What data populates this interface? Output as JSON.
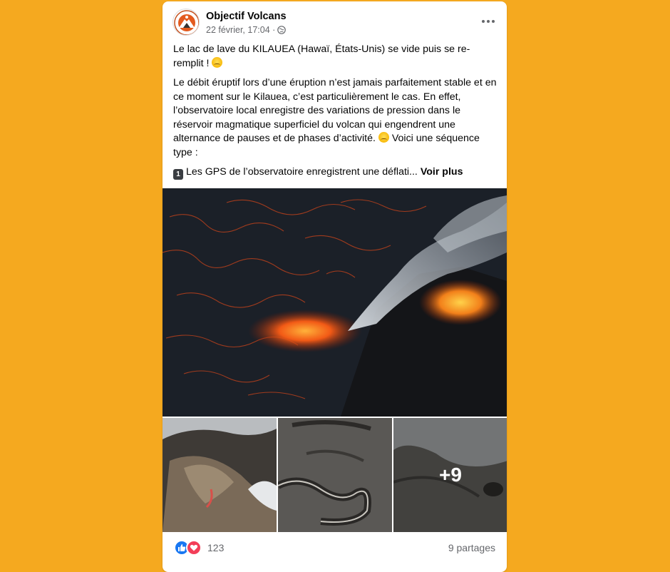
{
  "post": {
    "author": "Objectif Volcans",
    "date": "22 février, 17:04 ·",
    "paragraph1": "Le lac de lave du KILAUEA (Hawaï, États-Unis) se vide puis se re-remplit !",
    "paragraph2": "Le débit éruptif lors d’une éruption n’est jamais parfaitement stable et en ce moment sur le Kilauea, c’est particulièrement le cas. En effet, l’observatoire local enregistre des variations de pression dans le réservoir magmatique superficiel du volcan qui engendrent une alternance de pauses et de phases d’activité.",
    "paragraph2_end": "Voici une séquence type :",
    "keycap": "1",
    "paragraph3": "Les GPS de l’observatoire enregistrent une déflati...",
    "see_more": "Voir plus",
    "more_photos": "+9",
    "reaction_count": "123",
    "shares": "9 partages"
  },
  "colors": {
    "background": "#F5A91F",
    "like": "#1877F2",
    "love": "#F33E58"
  },
  "icons": [
    "more-options-icon",
    "globe-icon",
    "like-icon",
    "love-icon",
    "crying-emoji-icon",
    "keycap-one-icon"
  ]
}
